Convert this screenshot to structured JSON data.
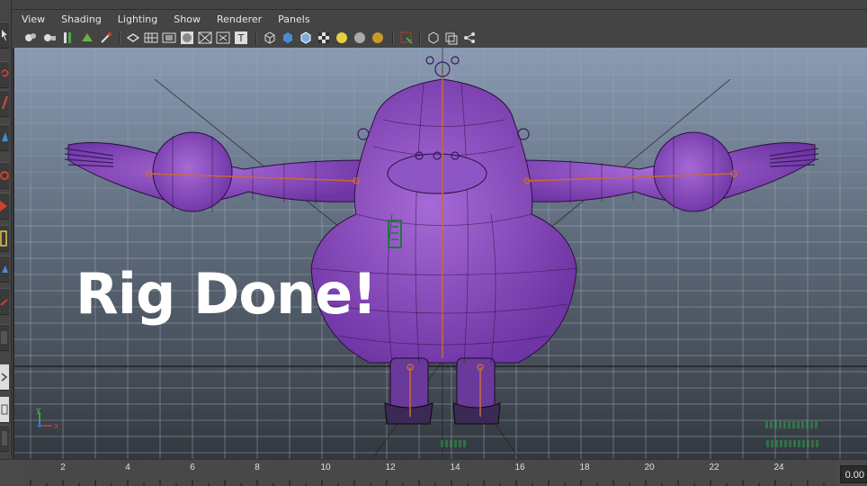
{
  "menu": {
    "items": [
      "View",
      "Shading",
      "Lighting",
      "Show",
      "Renderer",
      "Panels"
    ]
  },
  "icons": {
    "left_toolbar": [
      "select-tool-icon",
      "lasso-tool-icon",
      "paint-select-icon",
      "move-tool-icon",
      "rotate-tool-icon",
      "scale-tool-icon",
      "manipulator-icon",
      "last-tool-icon",
      "soft-mod-icon",
      "layout-icon",
      "outliner-icon",
      "graph-icon",
      "panel-layout-icon"
    ],
    "panel_toolbar": [
      "camera-select-icon",
      "camera-attributes-icon",
      "bookmark-icon",
      "image-plane-icon",
      "2d-pan-zoom-icon",
      "grease-pencil-icon",
      "grid-icon",
      "film-gate-icon",
      "resolution-gate-icon",
      "gate-mask-icon",
      "field-chart-icon",
      "safe-action-icon",
      "safe-title-icon",
      "wireframe-icon",
      "smooth-shade-icon",
      "wireframe-on-shaded-icon",
      "xray-icon",
      "default-light-icon",
      "shadows-icon",
      "ambient-occlusion-icon",
      "isolate-select-icon",
      "xray-joints-icon",
      "camera-icon",
      "xray-active-icon"
    ]
  },
  "viewport": {
    "overlay_text": "Rig Done!",
    "background_top": "#8a9bb3",
    "background_bottom": "#33383f",
    "mesh_color": "#7a3fb0",
    "joint_color": "#c86a3a",
    "control_color": "#1e7a3a",
    "axis": {
      "y": "y",
      "x": "x"
    }
  },
  "timeline": {
    "ticks": [
      "2",
      "4",
      "6",
      "8",
      "10",
      "12",
      "14",
      "16",
      "18",
      "20",
      "22",
      "24"
    ],
    "current_frame": "0.00"
  }
}
